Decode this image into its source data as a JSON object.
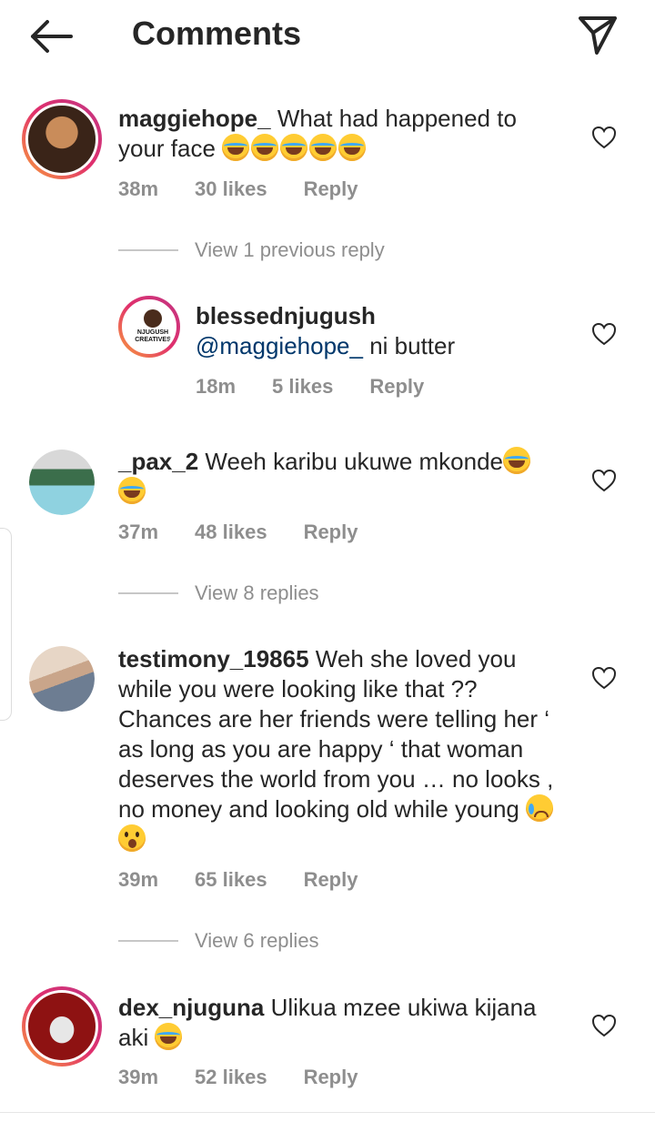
{
  "header": {
    "title": "Comments"
  },
  "comments": [
    {
      "username": "maggiehope_",
      "text": "What had happened to your face",
      "emojis": [
        "laugh",
        "laugh",
        "laugh",
        "laugh",
        "laugh"
      ],
      "time": "38m",
      "likes": "30 likes",
      "reply": "Reply",
      "view_replies": "View 1 previous reply",
      "avatar_colors": [
        "#c98c5a",
        "#3a2418"
      ]
    },
    {
      "username": "blessednjugush",
      "mention": "@maggiehope_",
      "text": "ni butter",
      "time": "18m",
      "likes": "5 likes",
      "reply": "Reply",
      "logo_text_1": "NJUGUSH",
      "logo_text_2": "CREATIVES"
    },
    {
      "username": "_pax_2",
      "text": "Weeh karibu ukuwe mkonde",
      "emojis": [
        "laugh",
        "laugh"
      ],
      "time": "37m",
      "likes": "48 likes",
      "reply": "Reply",
      "view_replies": "View 8 replies",
      "avatar_colors": [
        "#d8d8d8",
        "#3b6e4b"
      ]
    },
    {
      "username": "testimony_19865",
      "text": "Weh she loved you while you were looking like that ?? Chances are her friends were telling her ‘ as long as you are happy ‘ that woman deserves the world from you … no looks , no money and looking old while young",
      "emojis": [
        "cry",
        "wow"
      ],
      "time": "39m",
      "likes": "65 likes",
      "reply": "Reply",
      "view_replies": "View 6 replies",
      "avatar_colors": [
        "#e7d6c6",
        "#6d7d92"
      ]
    },
    {
      "username": "dex_njuguna",
      "text": "Ulikua mzee ukiwa kijana aki",
      "emojis": [
        "laugh"
      ],
      "time": "39m",
      "likes": "52 likes",
      "reply": "Reply",
      "avatar_colors": [
        "#8e1212",
        "#e7e7e7"
      ]
    }
  ]
}
